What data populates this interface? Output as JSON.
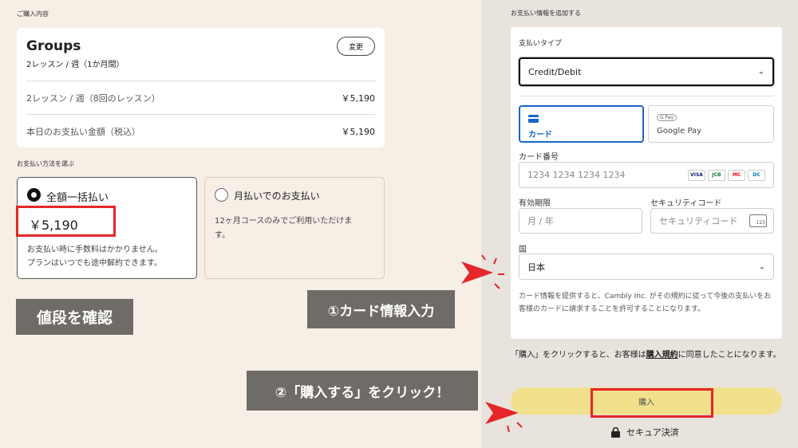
{
  "summary": {
    "section_title": "ご購入内容",
    "plan_name": "Groups",
    "plan_sub": "2レッスン / 週（1か月間）",
    "change_label": "変更",
    "rows": [
      {
        "label": "2レッスン / 週（8回のレッスン）",
        "amount": "￥5,190"
      },
      {
        "label": "本日のお支払い金額（税込）",
        "amount": "￥5,190"
      }
    ]
  },
  "payment_method": {
    "section_title": "お支払い方法を選ぶ",
    "options": [
      {
        "label": "全額一括払い",
        "price": "￥5,190",
        "note1": "お支払い時に手数料はかかりません。",
        "note2": "プランはいつでも途中解約できます。",
        "selected": true
      },
      {
        "label": "月払いでのお支払い",
        "note1": "12ヶ月コースのみでご利用いただけま",
        "note2": "す。",
        "selected": false
      }
    ]
  },
  "annotations": {
    "check_price": "値段を確認",
    "enter_card": "①カード情報入力",
    "click_buy": "②「購入する」をクリック！"
  },
  "form": {
    "section_title": "お支払い情報を追加する",
    "pay_type_label": "支払いタイプ",
    "pay_type_value": "Credit/Debit",
    "methods": [
      {
        "label": "カード",
        "icon": "card-icon",
        "selected": true
      },
      {
        "label": "Google Pay",
        "icon": "google-pay-icon",
        "selected": false
      }
    ],
    "gpay_badge": "G Pay",
    "card_number_label": "カード番号",
    "card_number_placeholder": "1234 1234 1234 1234",
    "brands": [
      "VISA",
      "JCB",
      "MC",
      "DC"
    ],
    "expiry_label": "有効期限",
    "expiry_placeholder": "月 / 年",
    "cvc_label": "セキュリティコード",
    "cvc_placeholder": "セキュリティコード",
    "cvc_icon_text": "123",
    "country_label": "国",
    "country_value": "日本",
    "disclaimer": "カード情報を提供すると、Cambly Inc. がその規約に従って今後の支払いをお客様のカードに請求することを許可することになります。",
    "agree_prefix": "「購入」をクリックすると、お客様は",
    "agree_link": "購入規約",
    "agree_suffix": "に同意したことになります。",
    "buy_label": "購入",
    "secure_label": "セキュア決済"
  },
  "colors": {
    "left_bg": "#f7efe6",
    "right_bg": "#e8e3dd",
    "accent_red": "#e5262a",
    "buy_button": "#f1e08b",
    "method_selected": "#1a66c9",
    "annotation_bg": "#6f6b66"
  }
}
